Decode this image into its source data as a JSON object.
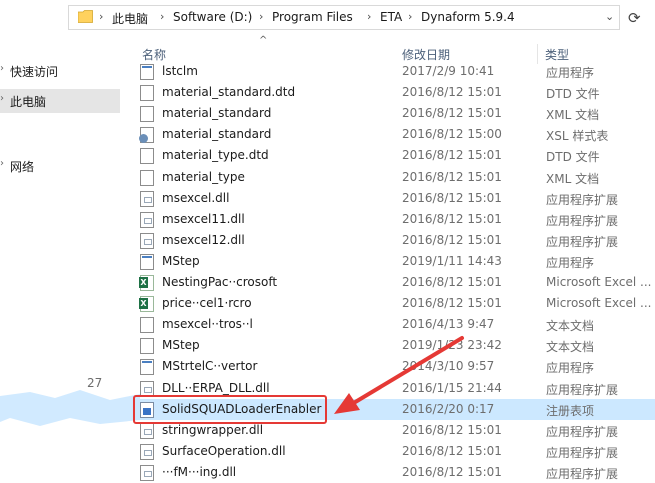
{
  "address_bar": {
    "crumbs": [
      "此电脑",
      "Software (D:)",
      "Program Files",
      "ETA",
      "Dynaform 5.9.4"
    ],
    "icons": [
      "folder-icon",
      "chevron-right-icon",
      "refresh-icon"
    ]
  },
  "nav": {
    "items": [
      {
        "label": "快速访问",
        "icon": "star-icon"
      },
      {
        "label": "此电脑",
        "icon": "computer-icon",
        "selected": true
      },
      {
        "label": "网络",
        "icon": "network-icon"
      }
    ]
  },
  "columns": {
    "name": "名称",
    "date": "修改日期",
    "type": "类型"
  },
  "files": [
    {
      "name": "lstclm",
      "date": "2017/2/9 10:41",
      "type": "应用程序",
      "icon": "exe-icon"
    },
    {
      "name": "material_standard.dtd",
      "date": "2016/8/12 15:01",
      "type": "DTD 文件",
      "icon": "document-icon"
    },
    {
      "name": "material_standard",
      "date": "2016/8/12 15:01",
      "type": "XML 文档",
      "icon": "document-icon"
    },
    {
      "name": "material_standard",
      "date": "2016/8/12 15:00",
      "type": "XSL 样式表",
      "icon": "xsl-icon"
    },
    {
      "name": "material_type.dtd",
      "date": "2016/8/12 15:01",
      "type": "DTD 文件",
      "icon": "document-icon"
    },
    {
      "name": "material_type",
      "date": "2016/8/12 15:01",
      "type": "XML 文档",
      "icon": "document-icon"
    },
    {
      "name": "msexcel.dll",
      "date": "2016/8/12 15:01",
      "type": "应用程序扩展",
      "icon": "dll-icon"
    },
    {
      "name": "msexcel11.dll",
      "date": "2016/8/12 15:01",
      "type": "应用程序扩展",
      "icon": "dll-icon"
    },
    {
      "name": "msexcel12.dll",
      "date": "2016/8/12 15:01",
      "type": "应用程序扩展",
      "icon": "dll-icon"
    },
    {
      "name": "MStep",
      "date": "2019/1/11 14:43",
      "type": "应用程序",
      "icon": "exe-icon"
    },
    {
      "name": "NestingPac··crosoft",
      "date": "2016/8/12 15:01",
      "type": "Microsoft Excel ...",
      "icon": "excel-icon"
    },
    {
      "name": "price··cel1·rcro",
      "date": "2016/8/12 15:01",
      "type": "Microsoft Excel ...",
      "icon": "excel-icon"
    },
    {
      "name": "msexcel··tros··l",
      "date": "2016/4/13 9:47",
      "type": "文本文档",
      "icon": "document-icon"
    },
    {
      "name": "MStep",
      "date": "2019/1/23 23:42",
      "type": "文本文档",
      "icon": "document-icon"
    },
    {
      "name": "MStrtelC··vertor",
      "date": "2014/3/10 9:57",
      "type": "应用程序",
      "icon": "exe-icon"
    },
    {
      "name": "DLL··ERPA_DLL.dll",
      "date": "2016/1/15 21:44",
      "type": "应用程序扩展",
      "icon": "dll-icon"
    },
    {
      "name": "SolidSQUADLoaderEnabler",
      "date": "2016/2/20 0:17",
      "type": "注册表项",
      "icon": "registry-icon",
      "selected": true
    },
    {
      "name": "stringwrapper.dll",
      "date": "2016/8/12 15:01",
      "type": "应用程序扩展",
      "icon": "dll-icon"
    },
    {
      "name": "SurfaceOperation.dll",
      "date": "2016/8/12 15:01",
      "type": "应用程序扩展",
      "icon": "dll-icon"
    },
    {
      "name": "···fM···ing.dll",
      "date": "2016/8/12 15:01",
      "type": "应用程序扩展",
      "icon": "dll-icon"
    }
  ],
  "side_number": "27",
  "colors": {
    "selection": "#cce8ff",
    "nav_selection": "#e5e5e5",
    "highlight_box": "#e53935",
    "arrow": "#e53935",
    "header_text": "#4c607a"
  }
}
